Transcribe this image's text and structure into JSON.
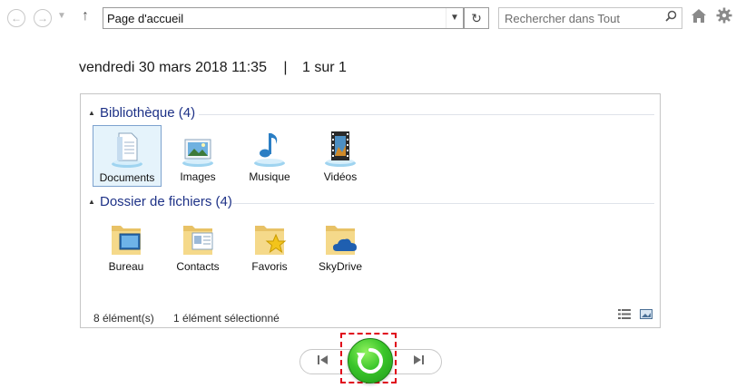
{
  "toolbar": {
    "address": "Page d'accueil",
    "search_placeholder": "Rechercher dans Tout"
  },
  "info": {
    "date": "vendredi 30 mars 2018",
    "time": "11:35",
    "separator": "|",
    "page": "1 sur 1"
  },
  "explorer": {
    "groups": [
      {
        "title": "Bibliothèque (4)",
        "items": [
          {
            "label": "Documents",
            "icon": "documents-library-icon"
          },
          {
            "label": "Images",
            "icon": "images-library-icon"
          },
          {
            "label": "Musique",
            "icon": "music-library-icon"
          },
          {
            "label": "Vidéos",
            "icon": "videos-library-icon"
          }
        ]
      },
      {
        "title": "Dossier de fichiers (4)",
        "items": [
          {
            "label": "Bureau",
            "icon": "desktop-folder-icon"
          },
          {
            "label": "Contacts",
            "icon": "contacts-folder-icon"
          },
          {
            "label": "Favoris",
            "icon": "favorites-folder-icon"
          },
          {
            "label": "SkyDrive",
            "icon": "skydrive-folder-icon"
          }
        ]
      }
    ],
    "status": {
      "count": "8 élément(s)",
      "selected": "1 élément sélectionné"
    }
  },
  "colors": {
    "group_title": "#1e3287",
    "selection_bg": "#e5f3fb",
    "restore_green": "#3ac52a",
    "highlight_red": "#e0001a"
  }
}
